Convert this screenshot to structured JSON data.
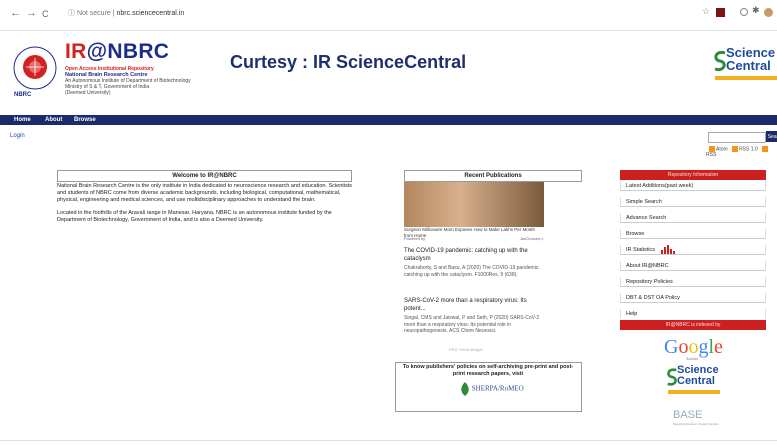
{
  "browser": {
    "back": "←",
    "forward": "→",
    "reload": "C",
    "security": "ⓘ Not secure",
    "url": "nbrc.sciencecentral.in"
  },
  "header": {
    "logo_prefix": "IR",
    "logo_main": "NBRC",
    "logo_lines": [
      "Open Access Institutional Repository",
      "National Brain Research Centre",
      "An Autonomous Institute of Department of Biotechnology",
      "Ministry of S & T, Government of India",
      "(Deemed University)"
    ],
    "curtesy": "Curtesy : IR ScienceCentral",
    "sc_logo_top": "Science",
    "sc_logo_bottom": "Central"
  },
  "nav": {
    "items": [
      "Home",
      "About",
      "Browse"
    ],
    "login": "Login",
    "search_button": "Sear",
    "feeds": [
      "Atom",
      "RSS 1.0",
      "RSS"
    ]
  },
  "welcome": {
    "title": "Welcome to IR@NBRC",
    "para1": "National Brain Research Centre is the only institute in India dedicated to neuroscience research and education. Scientists and students of NBRC come from diverse academic backgrounds, including biological, computational, mathematical, physical, engineering and medical sciences, and use multidisciplinary approaches to understand the brain.",
    "para2": "Located in the foothills of the Aravali range in Manesar, Haryana, NBRC is an autonomous institute funded by the Department of Biotechnology, Government of India, and is also a Deemed University."
  },
  "recent": {
    "title": "Recent Publications",
    "ad_caption": "Surgeon Millionaire Mom Exposes How to Make Lakhs Per Month from Home",
    "ad_powered": "Powered by",
    "ad_choices": "AdChoices",
    "pub1_title": "The COVID-19 pandemic: catching up with the cataclysm",
    "pub1_body": "Chakraborty, S and Basu, A (2020) The COVID-19 pandemic: catching up with the cataclysm. F1000Res, 9 (638).",
    "pub2_title": "SARS-CoV-2 more than a respiratory virus: Its potent...",
    "pub2_body": "Singal, CMS and Jaiswal, P and Seth, P (2020) SARS-CoV-2 more than a respiratory virus: Its potential role in neuropathogenesis. ACS Chem Neurosci.",
    "trend": "PDG Trend Widget",
    "policy": "To know publishers' policies on self-archiving pre-print and post-print research papers, visit",
    "sherpa": "SHERPA/RoMEO"
  },
  "sidebar": {
    "header": "Repository Information",
    "items": [
      "Latest Additions(past week)",
      "Simple Search",
      "Advance Search",
      "Browse",
      "IR Statistics",
      "About IR@NBRC",
      "Repository Policies",
      "DBT & DST OA Policy",
      "Help"
    ],
    "header2": "IR@NBRC is indexed by",
    "google": "Google",
    "google_sub": "Scholar",
    "base": "BASE",
    "base_sub": "Bielefeld Academic Search Engine"
  },
  "colors": {
    "navbar": "#1b2a6b",
    "sidebar_header": "#cc1f1f",
    "logo_blue": "#1d2b8c",
    "logo_red": "#d42020"
  }
}
